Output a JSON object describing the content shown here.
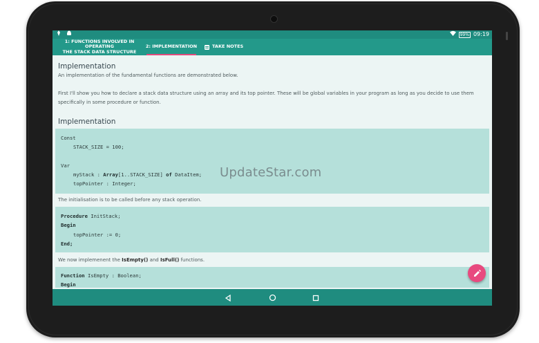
{
  "status_bar": {
    "battery": "99%",
    "time": "09:19"
  },
  "tabs": [
    {
      "label_line1": "1: FUNCTIONS INVOLVED IN OPERATING",
      "label_line2": "THE STACK DATA STRUCTURE"
    },
    {
      "label": "2: IMPLEMENTATION"
    },
    {
      "label": "TAKE NOTES"
    }
  ],
  "main": {
    "heading1": "Implementation",
    "intro": "An implementation of the fundamental functions are demonstrated below.",
    "para2_line1": "First I'll show you how to declare a stack data structure using an array and its top pointer. These will be global variables in your program as long as you decide to use them",
    "para2_line2": "specifically in some procedure or function.",
    "heading2": "Implementation",
    "code1": {
      "l1": "Const",
      "l2": "STACK_SIZE = 100;",
      "l3": "Var",
      "l4a": "myStack : ",
      "l4b": "Array",
      "l4c": "[1..STACK_SIZE] ",
      "l4d": "of",
      "l4e": " DataItem;",
      "l5": "topPointer : Integer;"
    },
    "para3": "The initialisation is to be called before any stack operation.",
    "code2": {
      "l1a": "Procedure",
      "l1b": " InitStack;",
      "l2": "Begin",
      "l3": "topPointer := 0;",
      "l4": "End;"
    },
    "para4_a": "We now implemenent the ",
    "para4_b": "IsEmpty()",
    "para4_c": " and ",
    "para4_d": "IsFull()",
    "para4_e": " functions.",
    "code3": {
      "l1a": "Function",
      "l1b": " IsEmpty : Boolean;",
      "l2": "Begin"
    }
  },
  "watermark": "UpdateStar.com",
  "icons": {
    "fab": "pencil-icon",
    "nav": [
      "back-icon",
      "home-icon",
      "recents-icon"
    ]
  },
  "colors": {
    "primary": "#23998a",
    "primary_dark": "#1f8c7f",
    "accent": "#e84a7f",
    "code_bg": "#b5e0da",
    "page_bg": "#ecf5f4"
  }
}
